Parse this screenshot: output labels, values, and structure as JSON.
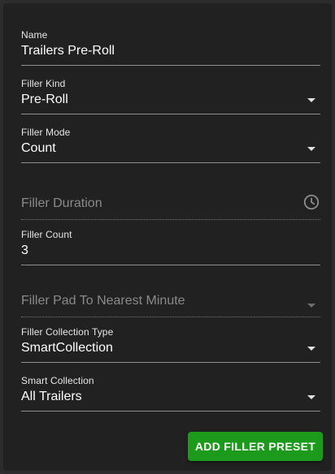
{
  "form": {
    "name": {
      "label": "Name",
      "value": "Trailers Pre-Roll"
    },
    "filler_kind": {
      "label": "Filler Kind",
      "value": "Pre-Roll"
    },
    "filler_mode": {
      "label": "Filler Mode",
      "value": "Count"
    },
    "filler_duration": {
      "placeholder": "Filler Duration",
      "icon": "clock-icon"
    },
    "filler_count": {
      "label": "Filler Count",
      "value": "3"
    },
    "filler_pad": {
      "placeholder": "Filler Pad To Nearest Minute"
    },
    "filler_collection_type": {
      "label": "Filler Collection Type",
      "value": "SmartCollection"
    },
    "smart_collection": {
      "label": "Smart Collection",
      "value": "All Trailers"
    }
  },
  "actions": {
    "add_label": "ADD FILLER PRESET"
  },
  "colors": {
    "accent": "#1b9a1b",
    "background": "#212121"
  }
}
